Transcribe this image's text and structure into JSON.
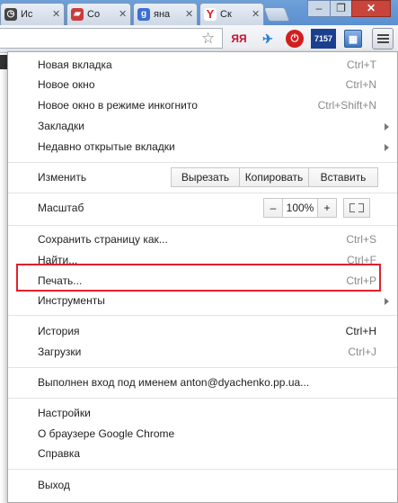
{
  "tabs": [
    {
      "label": "Ис",
      "icon": "clock-icon",
      "color": "#444444"
    },
    {
      "label": "Со",
      "icon": "car-icon",
      "color": "#cc3b3b"
    },
    {
      "label": "яна",
      "icon": "google-g-icon",
      "glyph": "g",
      "color": "#3b6fd1"
    },
    {
      "label": "Ск",
      "icon": "yandex-y-icon",
      "glyph": "Y",
      "color": "#e02020"
    }
  ],
  "window_controls": {
    "minimize": "–",
    "maximize": "❐",
    "close": "✕"
  },
  "toolbar": {
    "star": "☆",
    "extensions": [
      {
        "name": "yandex-translate-ext-icon",
        "text": "ЯЯ",
        "color": "#c8102e"
      },
      {
        "name": "bird-ext-icon",
        "text": "✈",
        "color": "#2f7fd0"
      },
      {
        "name": "stop-ext-icon",
        "text": "✋",
        "color": "#d11f1f"
      },
      {
        "name": "counter-ext-icon",
        "text": "7157",
        "color": "#1b3f8f"
      }
    ]
  },
  "menu": {
    "items_top": [
      {
        "label": "Новая вкладка",
        "shortcut": "Ctrl+T"
      },
      {
        "label": "Новое окно",
        "shortcut": "Ctrl+N"
      },
      {
        "label": "Новое окно в режиме инкогнито",
        "shortcut": "Ctrl+Shift+N"
      },
      {
        "label": "Закладки",
        "submenu": true
      },
      {
        "label": "Недавно открытые вкладки",
        "submenu": true
      }
    ],
    "edit": {
      "label": "Изменить",
      "cut": "Вырезать",
      "copy": "Копировать",
      "paste": "Вставить"
    },
    "zoom": {
      "label": "Масштаб",
      "minus": "–",
      "value": "100%",
      "plus": "+"
    },
    "items_middle": [
      {
        "label": "Сохранить страницу как...",
        "shortcut": "Ctrl+S"
      },
      {
        "label": "Найти...",
        "shortcut": "Ctrl+F"
      },
      {
        "label": "Печать...",
        "shortcut": "Ctrl+P"
      },
      {
        "label": "Инструменты",
        "submenu": true
      }
    ],
    "items_history": [
      {
        "label": "История",
        "shortcut": "Ctrl+H",
        "highlighted": true
      },
      {
        "label": "Загрузки",
        "shortcut": "Ctrl+J"
      }
    ],
    "signed_in": "Выполнен вход под именем anton@dyachenko.pp.ua...",
    "items_settings": [
      {
        "label": "Настройки"
      },
      {
        "label": "О браузере Google Chrome"
      },
      {
        "label": "Справка"
      }
    ],
    "exit": "Выход"
  },
  "colors": {
    "highlight_border": "#e0202c",
    "tabstrip": "#5b8fcf"
  }
}
